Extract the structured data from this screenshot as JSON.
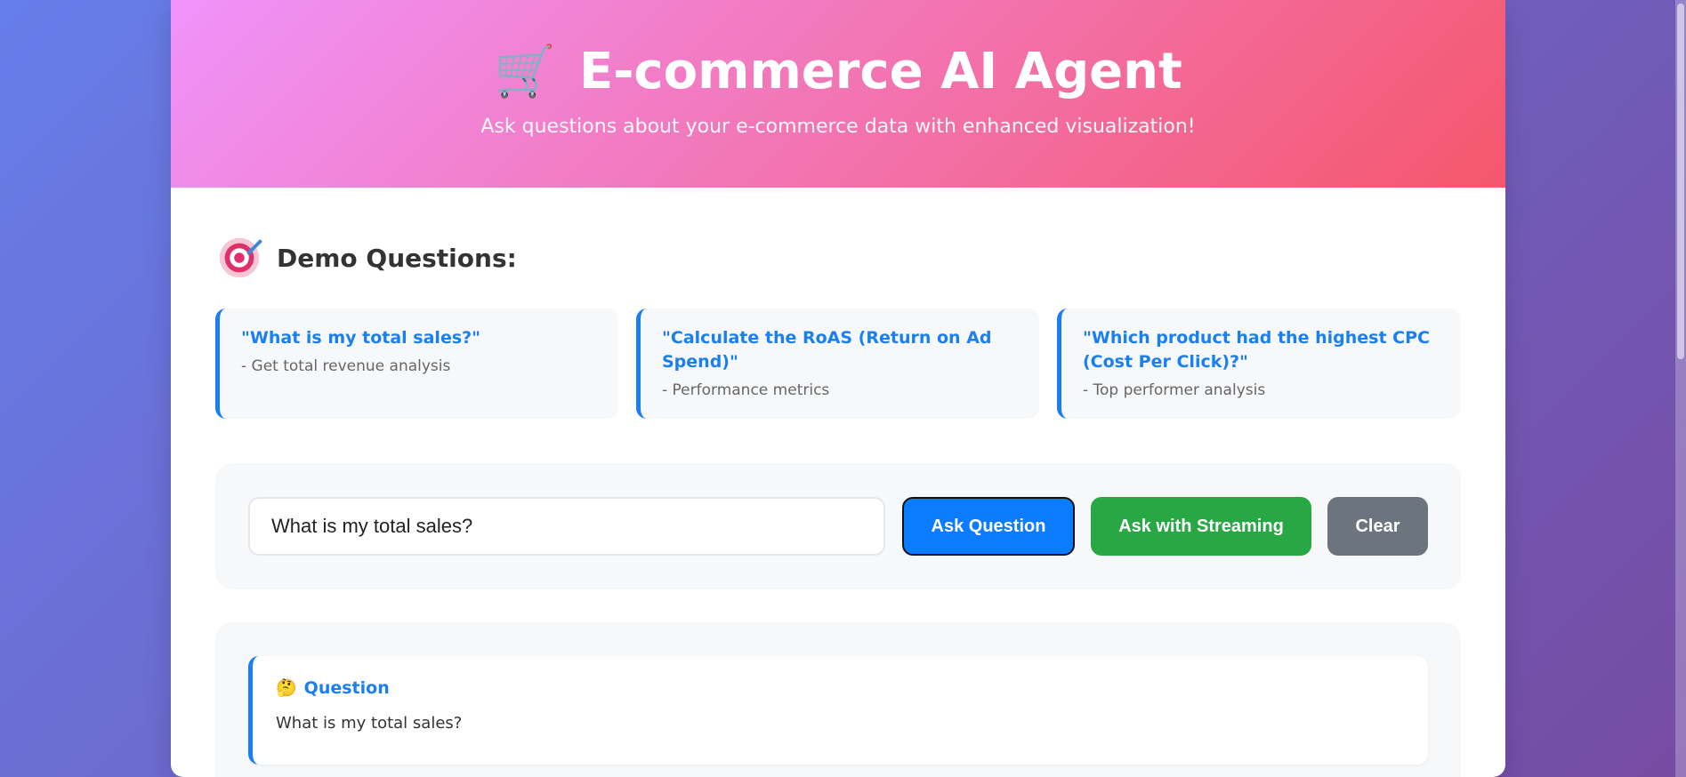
{
  "header": {
    "icon": "shopping-cart-icon",
    "cart_glyph": "🛒",
    "title": "E-commerce AI Agent",
    "subtitle": "Ask questions about your e-commerce data with enhanced visualization!"
  },
  "demo": {
    "icon": "target-icon",
    "title": "Demo Questions:",
    "cards": [
      {
        "question": "\"What is my total sales?\"",
        "description": "- Get total revenue analysis"
      },
      {
        "question": "\"Calculate the RoAS (Return on Ad Spend)\"",
        "description": "- Performance metrics"
      },
      {
        "question": "\"Which product had the highest CPC (Cost Per Click)?\"",
        "description": "- Top performer analysis"
      }
    ]
  },
  "form": {
    "input_value": "What is my total sales?",
    "ask_label": "Ask Question",
    "stream_label": "Ask with Streaming",
    "clear_label": "Clear"
  },
  "result": {
    "icon": "thinking-face-icon",
    "icon_glyph": "🤔",
    "label": "Question",
    "text": "What is my total sales?"
  },
  "colors": {
    "accent": "#1a7ff2",
    "ask_button": "#0b7cff",
    "stream_button": "#28a745",
    "clear_button": "#6c757d",
    "header_gradient_start": "#f093fb",
    "header_gradient_end": "#f5576c"
  }
}
